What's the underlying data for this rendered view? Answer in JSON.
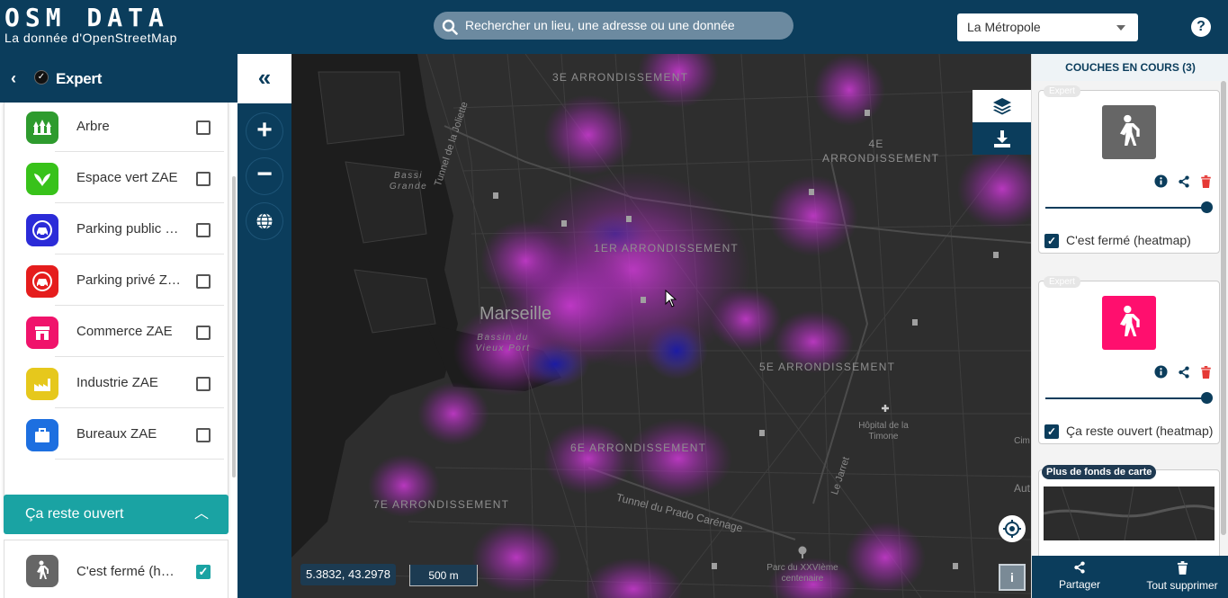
{
  "header": {
    "logo_title": "OSM DATA",
    "logo_subtitle": "La donnée d'OpenStreetMap",
    "search_placeholder": "Rechercher un lieu, une adresse ou une donnée",
    "territory_select": "La Métropole",
    "help_label": "?"
  },
  "left_panel": {
    "back_label": "‹",
    "title": "Expert",
    "layers": [
      {
        "name": "Arbre",
        "color": "#2e9b2e",
        "icon": "tree-icon",
        "checked": false
      },
      {
        "name": "Espace vert ZAE",
        "color": "#38c21a",
        "icon": "leaf-icon",
        "checked": false
      },
      {
        "name": "Parking public ZAE",
        "color": "#2b2bd8",
        "icon": "car-icon",
        "checked": false
      },
      {
        "name": "Parking privé ZAE",
        "color": "#e51d1d",
        "icon": "car-icon",
        "checked": false
      },
      {
        "name": "Commerce ZAE",
        "color": "#f0136b",
        "icon": "store-icon",
        "checked": false
      },
      {
        "name": "Industrie ZAE",
        "color": "#e6c81c",
        "icon": "factory-icon",
        "checked": false
      },
      {
        "name": "Bureaux ZAE",
        "color": "#1d6fe0",
        "icon": "briefcase-icon",
        "checked": false
      }
    ],
    "section_title": "Ça reste ouvert",
    "section_layer": {
      "name": "C'est fermé (heatmap)",
      "color": "#666666",
      "icon": "walker-icon",
      "checked": true
    }
  },
  "toolbar": {
    "collapse_label": "«",
    "zoom_in_label": "+",
    "zoom_out_label": "−"
  },
  "map": {
    "city_label": "Marseille",
    "districts": [
      "3E ARRONDISSEMENT",
      "4E ARRONDISSEMENT",
      "1ER ARRONDISSEMENT",
      "5E ARRONDISSEMENT",
      "6E ARRONDISSEMENT",
      "7E ARRONDISSEMENT"
    ],
    "places": [
      "Bassi Grande",
      "Bassin du Vieux Port",
      "Hôpital de la Timone",
      "Parc du XXVIème centenaire"
    ],
    "streets": [
      "Tunnel du Prado Carénage",
      "Tunnel de la Joliette",
      "Le Jarret"
    ],
    "coordinates": "5.3832, 43.2978",
    "scale": "500 m",
    "info_label": "i",
    "edge_labels": [
      "Cim",
      "Aut"
    ]
  },
  "right_panel": {
    "title": "COUCHES EN COURS (3)",
    "cards": [
      {
        "tag": "Expert",
        "name": "C'est fermé (heatmap)",
        "color": "#666666",
        "opacity": 1.0
      },
      {
        "tag": "Expert",
        "name": "Ça reste ouvert (heatmap)",
        "color": "#ff0f6e",
        "opacity": 1.0
      }
    ],
    "basemap_tag": "Plus de fonds de carte",
    "share_label": "Partager",
    "delete_all_label": "Tout supprimer"
  }
}
